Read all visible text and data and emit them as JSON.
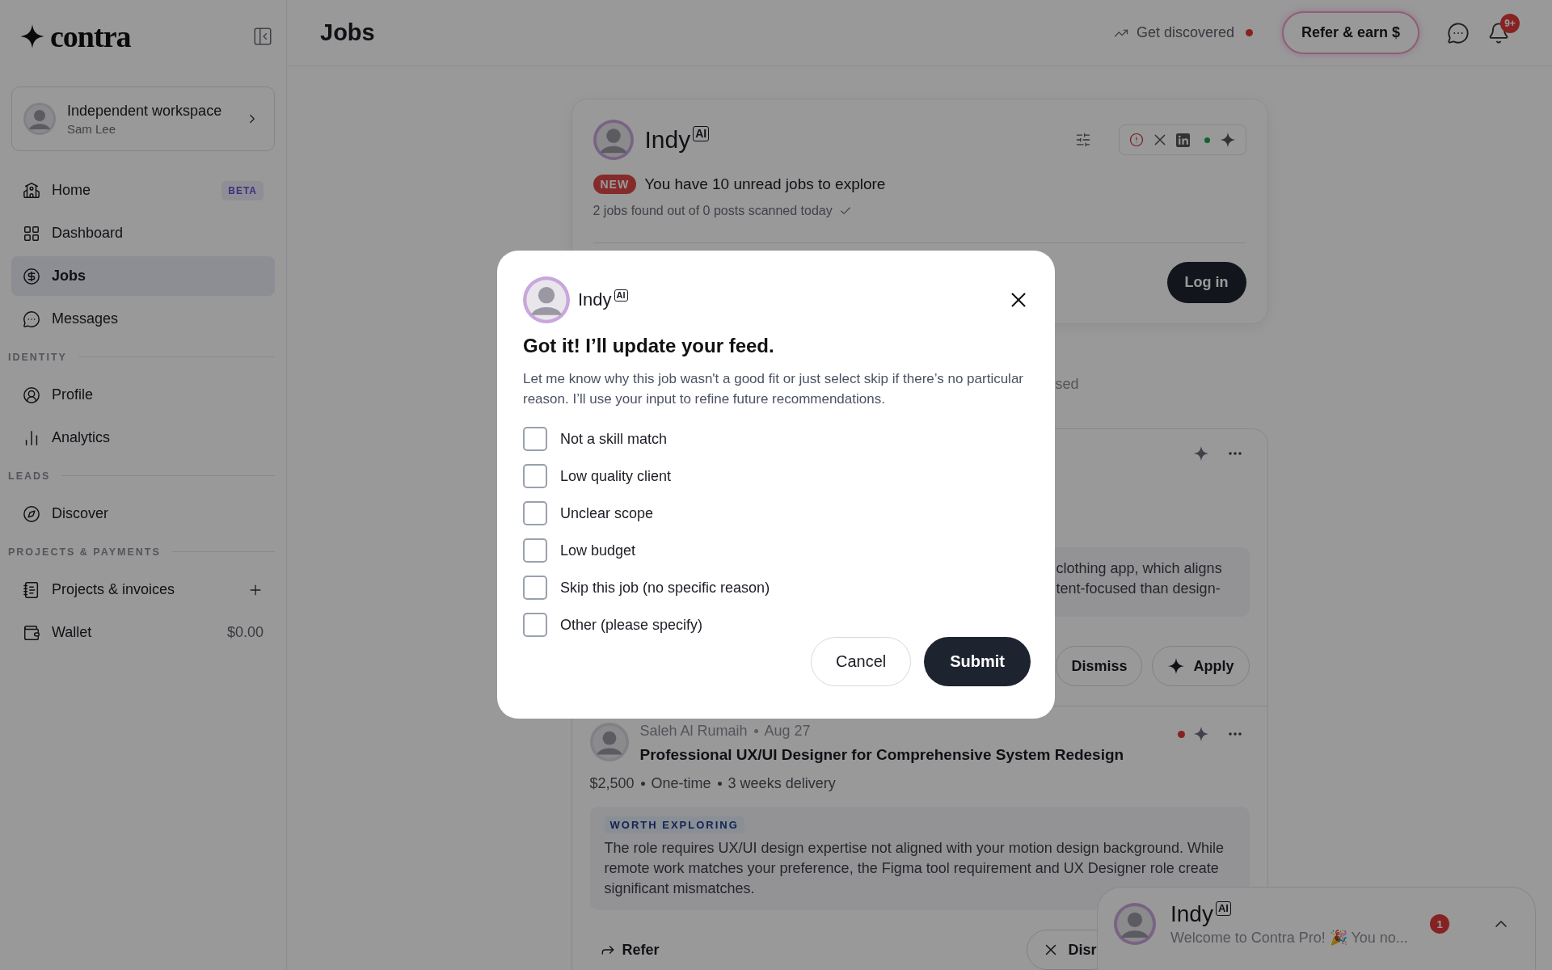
{
  "sidebar": {
    "logo": "contra",
    "workspace": {
      "name": "Independent workspace",
      "user": "Sam Lee"
    },
    "sections": [
      {
        "items": [
          {
            "label": "Home",
            "badge": "BETA",
            "selected": false
          },
          {
            "label": "Dashboard",
            "selected": false
          },
          {
            "label": "Jobs",
            "selected": true
          },
          {
            "label": "Messages",
            "selected": false
          }
        ]
      },
      {
        "heading": "IDENTITY",
        "items": [
          {
            "label": "Profile",
            "selected": false
          },
          {
            "label": "Analytics",
            "selected": false
          }
        ]
      },
      {
        "heading": "LEADS",
        "items": [
          {
            "label": "Discover",
            "selected": false
          }
        ]
      },
      {
        "heading": "PROJECTS & PAYMENTS",
        "items": [
          {
            "label": "Projects & invoices",
            "add_action": true,
            "selected": false
          },
          {
            "label": "Wallet",
            "value": "$0.00",
            "selected": false
          }
        ]
      }
    ]
  },
  "header": {
    "title": "Jobs",
    "get_discovered": "Get discovered",
    "refer": "Refer & earn $",
    "notifications_badge": "9+"
  },
  "indy_card": {
    "name": "Indy",
    "ai_tag": "AI",
    "new_badge": "NEW",
    "headline": "You have 10 unread jobs to explore",
    "scanned": "2 jobs found out of 0 posts scanned today",
    "login": "Log in"
  },
  "tabs_fragment": "sed",
  "jobs": [
    {
      "unread": false,
      "summary_lines": [
        "clothing app, which aligns",
        "tent-focused than design-"
      ],
      "dismiss": "Dismiss",
      "apply": "Apply"
    },
    {
      "unread": true,
      "client": "Saleh Al Rumaih",
      "date": "Aug 27",
      "title": "Professional UX/UI Designer for Comprehensive System Redesign",
      "meta": [
        "$2,500",
        "One-time",
        "3 weeks delivery"
      ],
      "tag": "WORTH EXPLORING",
      "summary": "The role requires UX/UI design expertise not aligned with your motion design background. While remote work matches your preference, the Figma tool requirement and UX Designer role create significant mismatches.",
      "refer": "Refer",
      "dismiss": "Disr"
    }
  ],
  "modal": {
    "name": "Indy",
    "ai_tag": "AI",
    "title": "Got it! I’ll update your feed.",
    "body": "Let me know why this job wasn't a good fit or just select skip if there’s no particular reason. I’ll use your input to refine future recommendations.",
    "options": [
      {
        "label": "Not a skill match",
        "checked": false
      },
      {
        "label": "Low quality client",
        "checked": false
      },
      {
        "label": "Unclear scope",
        "checked": false
      },
      {
        "label": "Low budget",
        "checked": false
      },
      {
        "label": "Skip this job (no specific reason)",
        "checked": false
      },
      {
        "label": "Other (please specify)",
        "checked": false
      }
    ],
    "cancel": "Cancel",
    "submit": "Submit"
  },
  "chat_widget": {
    "name": "Indy",
    "ai_tag": "AI",
    "preview": "Welcome to Contra Pro! 🎉 You no...",
    "unread_count": "1"
  }
}
